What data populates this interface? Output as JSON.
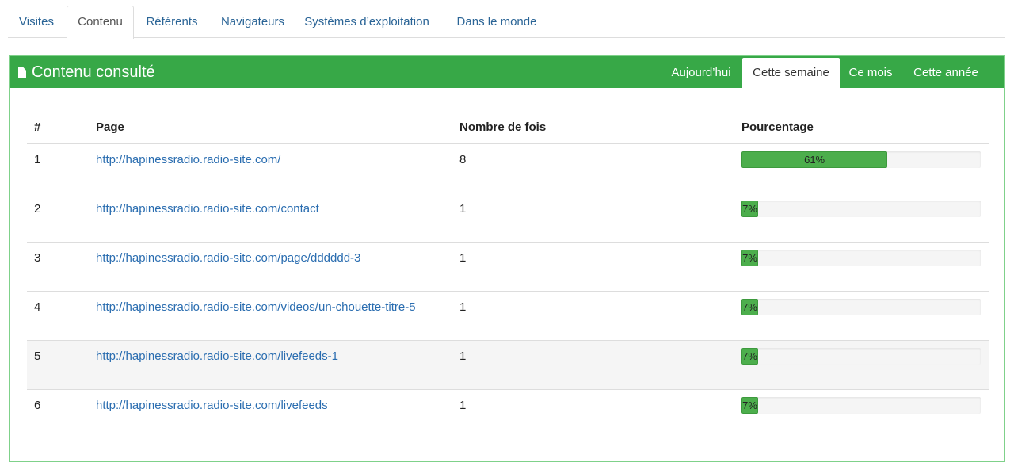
{
  "top_tabs": [
    {
      "label": "Visites",
      "active": false
    },
    {
      "label": "Contenu",
      "active": true
    },
    {
      "label": "Référents",
      "active": false
    },
    {
      "label": "Navigateurs",
      "active": false
    },
    {
      "label": "Systèmes d’exploitation",
      "active": false
    },
    {
      "label": "Dans le monde",
      "active": false
    }
  ],
  "panel": {
    "title": "Contenu consulté",
    "title_icon": "document-icon",
    "header_color": "#37a847",
    "periods": [
      {
        "label": "Aujourd’hui",
        "active": false
      },
      {
        "label": "Cette semaine",
        "active": true
      },
      {
        "label": "Ce mois",
        "active": false
      },
      {
        "label": "Cette année",
        "active": false
      }
    ]
  },
  "table": {
    "columns": [
      "#",
      "Page",
      "Nombre de fois",
      "Pourcentage"
    ],
    "rows": [
      {
        "rank": "1",
        "page": "http://hapinessradio.radio-site.com/",
        "count": "8",
        "percent_label": "61%",
        "percent": 61
      },
      {
        "rank": "2",
        "page": "http://hapinessradio.radio-site.com/contact",
        "count": "1",
        "percent_label": "7%",
        "percent": 7
      },
      {
        "rank": "3",
        "page": "http://hapinessradio.radio-site.com/page/dddddd-3",
        "count": "1",
        "percent_label": "7%",
        "percent": 7
      },
      {
        "rank": "4",
        "page": "http://hapinessradio.radio-site.com/videos/un-chouette-titre-5",
        "count": "1",
        "percent_label": "7%",
        "percent": 7
      },
      {
        "rank": "5",
        "page": "http://hapinessradio.radio-site.com/livefeeds-1",
        "count": "1",
        "percent_label": "7%",
        "percent": 7
      },
      {
        "rank": "6",
        "page": "http://hapinessradio.radio-site.com/livefeeds",
        "count": "1",
        "percent_label": "7%",
        "percent": 7
      }
    ]
  }
}
